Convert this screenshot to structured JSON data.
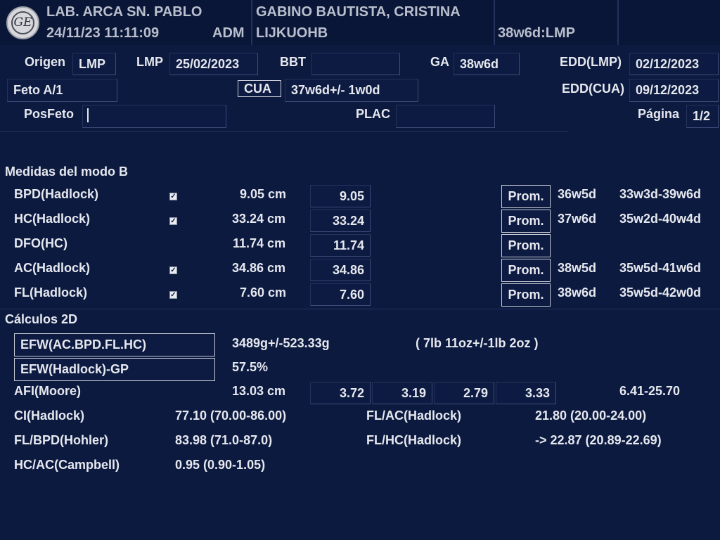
{
  "header": {
    "institution": "LAB. ARCA SN. PABLO",
    "datetime": "24/11/23 11:11:09",
    "operator": "ADM",
    "patient_name": "GABINO BAUTISTA, CRISTINA",
    "patient_id": "LIJKUOHB",
    "ga_summary": "38w6d:LMP",
    "logo_text": "GE"
  },
  "patient_info": {
    "origen_label": "Origen",
    "origen_value": "LMP",
    "lmp_label": "LMP",
    "lmp_value": "25/02/2023",
    "bbt_label": "BBT",
    "bbt_value": "",
    "ga_label": "GA",
    "ga_value": "38w6d",
    "edd_lmp_label": "EDD(LMP)",
    "edd_lmp_value": "02/12/2023",
    "feto": "Feto A/1",
    "cua_label": "CUA",
    "cua_value": "37w6d+/- 1w0d",
    "edd_cua_label": "EDD(CUA)",
    "edd_cua_value": "09/12/2023",
    "posfeto_label": "PosFeto",
    "posfeto_value": "",
    "plac_label": "PLAC",
    "plac_value": "",
    "pagina_label": "Página",
    "pagina_value": "1/2"
  },
  "bmode": {
    "title": "Medidas del modo B",
    "prom_label": "Prom.",
    "rows": [
      {
        "name": "BPD(Hadlock)",
        "checked": true,
        "measured": "9.05 cm",
        "value": "9.05",
        "ga": "36w5d",
        "range": "33w3d-39w6d"
      },
      {
        "name": "HC(Hadlock)",
        "checked": true,
        "measured": "33.24 cm",
        "value": "33.24",
        "ga": "37w6d",
        "range": "35w2d-40w4d"
      },
      {
        "name": "DFO(HC)",
        "checked": false,
        "measured": "11.74 cm",
        "value": "11.74",
        "ga": "",
        "range": ""
      },
      {
        "name": "AC(Hadlock)",
        "checked": true,
        "measured": "34.86 cm",
        "value": "34.86",
        "ga": "38w5d",
        "range": "35w5d-41w6d"
      },
      {
        "name": "FL(Hadlock)",
        "checked": true,
        "measured": "7.60 cm",
        "value": "7.60",
        "ga": "38w6d",
        "range": "35w5d-42w0d"
      }
    ]
  },
  "calc": {
    "title": "Cálculos 2D",
    "efw_label": "EFW(AC.BPD.FL.HC)",
    "efw_value": "3489g+/-523.33g",
    "efw_imperial": "( 7lb 11oz+/-1lb 2oz )",
    "efw_gp_label": "EFW(Hadlock)-GP",
    "efw_gp_value": "57.5%",
    "afi_label": "AFI(Moore)",
    "afi_value": "13.03 cm",
    "afi_quadrants": [
      "3.72",
      "3.19",
      "2.79",
      "3.33"
    ],
    "afi_range": "6.41-25.70",
    "ci_label": "CI(Hadlock)",
    "ci_value": "77.10  (70.00-86.00)",
    "flac_label": "FL/AC(Hadlock)",
    "flac_value": "21.80  (20.00-24.00)",
    "flbpd_label": "FL/BPD(Hohler)",
    "flbpd_value": "83.98  (71.0-87.0)",
    "flhc_label": "FL/HC(Hadlock)",
    "flhc_value": "-> 22.87  (20.89-22.69)",
    "hcac_label": "HC/AC(Campbell)",
    "hcac_value": "0.95  (0.90-1.05)"
  }
}
